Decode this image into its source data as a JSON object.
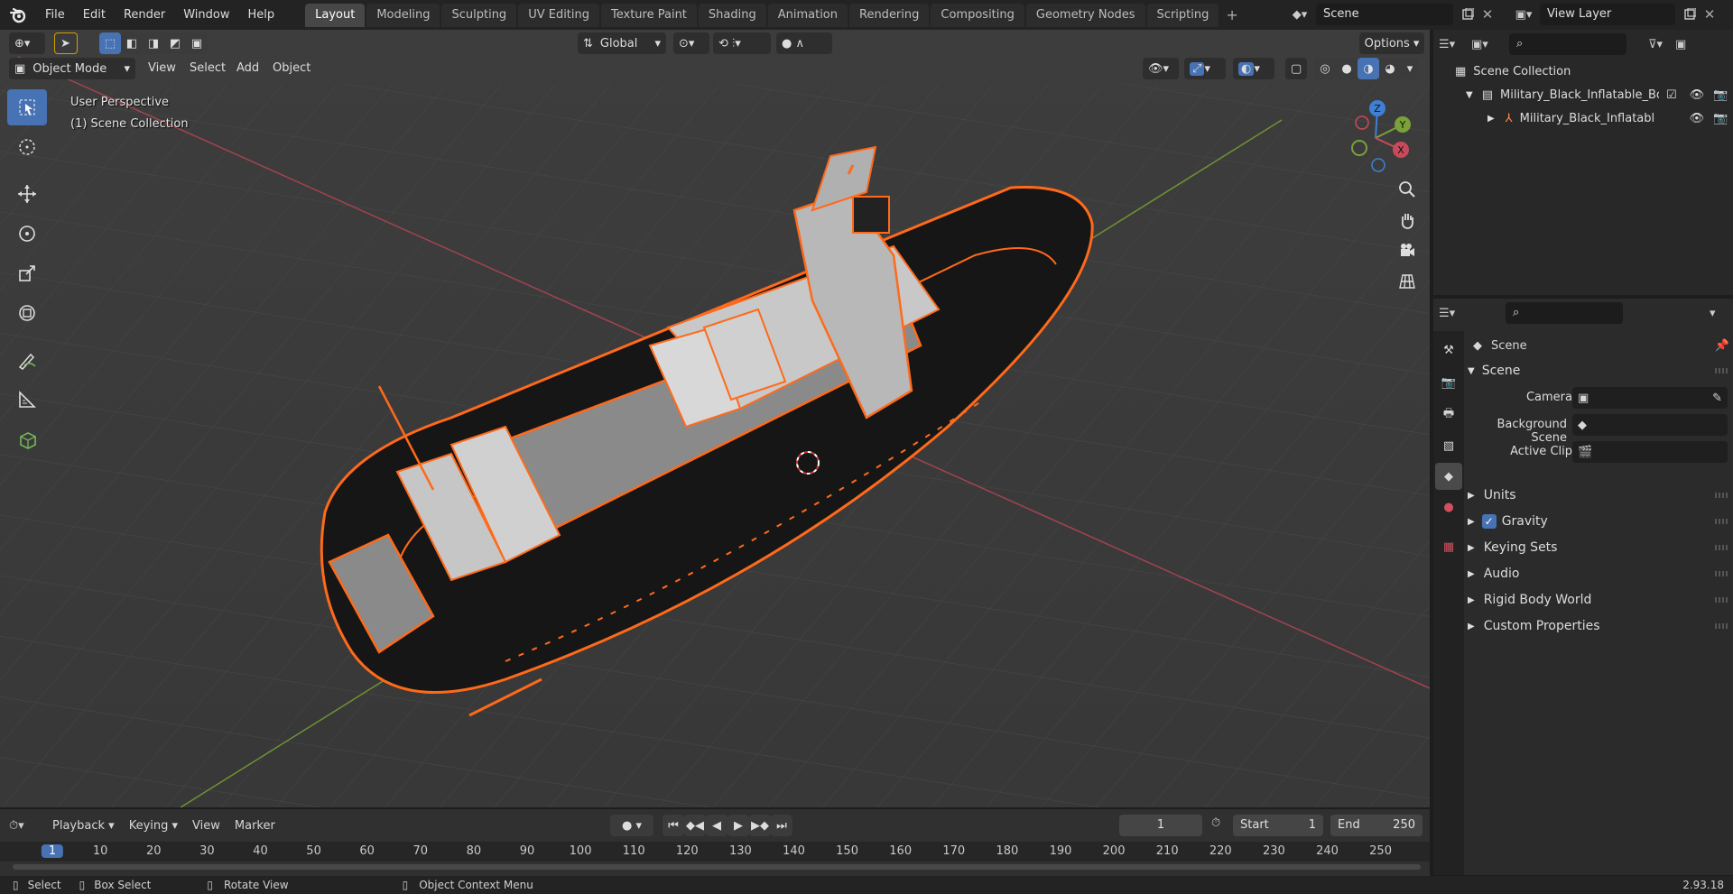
{
  "menu": {
    "items": [
      "File",
      "Edit",
      "Render",
      "Window",
      "Help"
    ]
  },
  "workspaces": {
    "tabs": [
      "Layout",
      "Modeling",
      "Sculpting",
      "UV Editing",
      "Texture Paint",
      "Shading",
      "Animation",
      "Rendering",
      "Compositing",
      "Geometry Nodes",
      "Scripting"
    ],
    "active": "Layout",
    "add_label": "+"
  },
  "scene_field": {
    "value": "Scene"
  },
  "view_layer_field": {
    "value": "View Layer"
  },
  "viewport": {
    "transform_orientation": "Global",
    "options_label": "Options",
    "mode": "Object Mode",
    "menus": [
      "View",
      "Select",
      "Add",
      "Object"
    ],
    "overlay_line1": "User Perspective",
    "overlay_line2": "(1) Scene Collection",
    "gizmo": {
      "x": "X",
      "y": "Y",
      "z": "Z"
    }
  },
  "outliner": {
    "root": "Scene Collection",
    "collection": "Military_Black_Inflatable_Boat",
    "object": "Military_Black_Inflatable_"
  },
  "properties": {
    "breadcrumb": "Scene",
    "panel_title": "Scene",
    "fields": {
      "camera_label": "Camera",
      "background_scene_label": "Background Scene",
      "active_clip_label": "Active Clip"
    },
    "sections": [
      "Units",
      "Gravity",
      "Keying Sets",
      "Audio",
      "Rigid Body World",
      "Custom Properties"
    ],
    "gravity_checked": true
  },
  "timeline": {
    "menus": [
      "Playback",
      "Keying",
      "View",
      "Marker"
    ],
    "current_frame": "1",
    "start_label": "Start",
    "start_value": "1",
    "end_label": "End",
    "end_value": "250",
    "ruler_ticks": [
      "1",
      "10",
      "20",
      "30",
      "40",
      "50",
      "60",
      "70",
      "80",
      "90",
      "100",
      "110",
      "120",
      "130",
      "140",
      "150",
      "160",
      "170",
      "180",
      "190",
      "200",
      "210",
      "220",
      "230",
      "240",
      "250"
    ]
  },
  "statusbar": {
    "select": "Select",
    "box_select": "Box Select",
    "rotate_view": "Rotate View",
    "context_menu": "Object Context Menu",
    "version": "2.93.18"
  },
  "colors": {
    "accent": "#4772b3",
    "selection_orange": "#ff6a1a",
    "axis_x": "#c84a5a",
    "axis_y": "#7aa13a",
    "axis_z": "#3f7fd6"
  }
}
